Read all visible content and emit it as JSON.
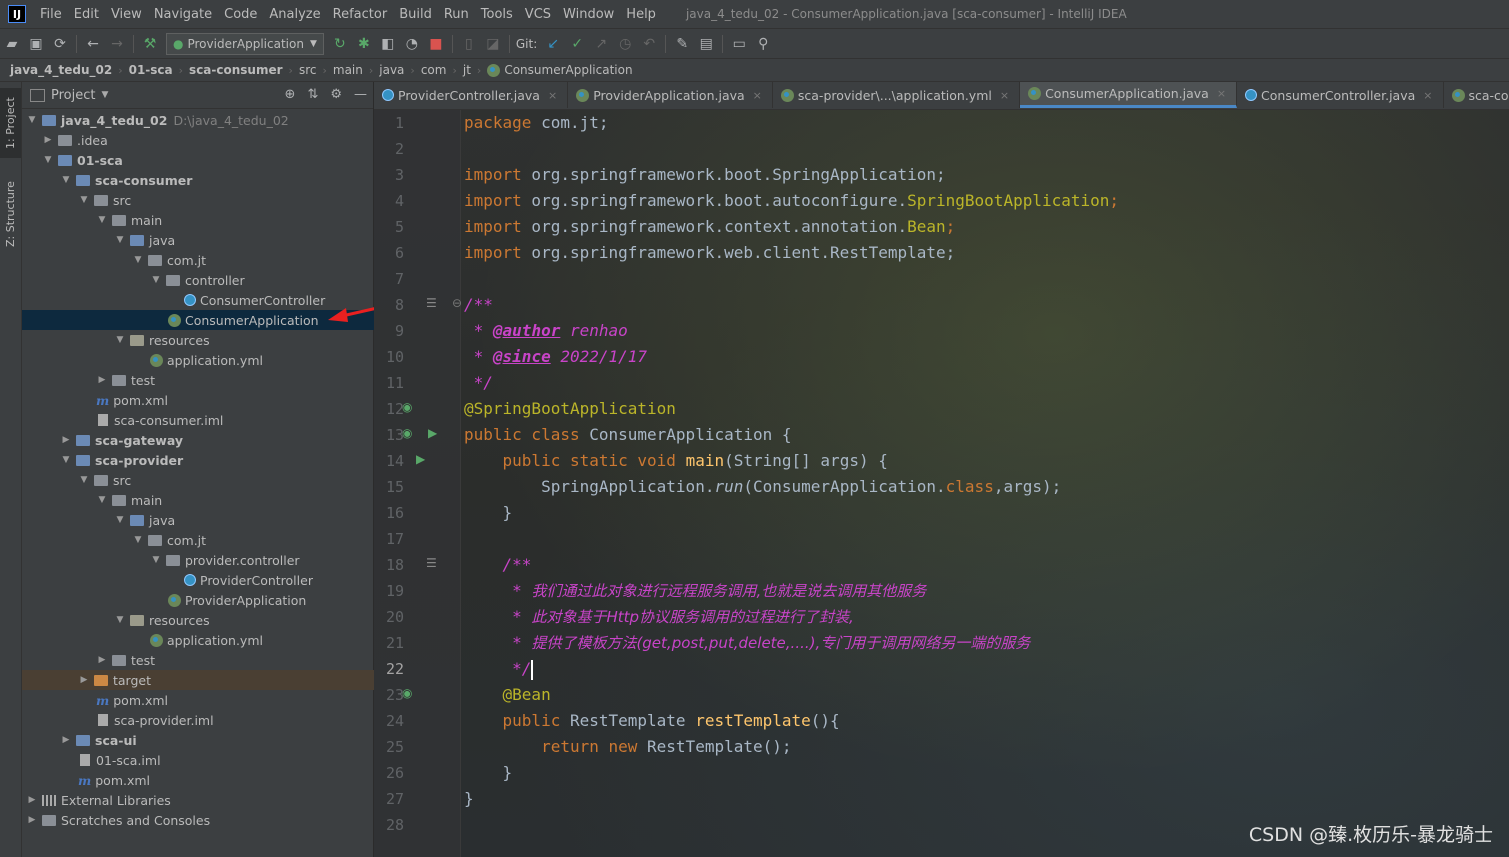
{
  "window": {
    "title": "java_4_tedu_02 - ConsumerApplication.java [sca-consumer] - IntelliJ IDEA"
  },
  "menu": [
    "File",
    "Edit",
    "View",
    "Navigate",
    "Code",
    "Analyze",
    "Refactor",
    "Build",
    "Run",
    "Tools",
    "VCS",
    "Window",
    "Help"
  ],
  "toolbar": {
    "run_config": "ProviderApplication",
    "git_label": "Git:"
  },
  "breadcrumb": [
    "java_4_tedu_02",
    "01-sca",
    "sca-consumer",
    "src",
    "main",
    "java",
    "com",
    "jt",
    "ConsumerApplication"
  ],
  "left_strip": {
    "project_tab": "1: Project",
    "structure_tab": "Z: Structure"
  },
  "project_panel": {
    "title": "Project",
    "tree": [
      {
        "label": "java_4_tedu_02",
        "path": "D:\\java_4_tedu_02"
      },
      {
        "label": ".idea"
      },
      {
        "label": "01-sca"
      },
      {
        "label": "sca-consumer"
      },
      {
        "label": "src"
      },
      {
        "label": "main"
      },
      {
        "label": "java"
      },
      {
        "label": "com.jt"
      },
      {
        "label": "controller"
      },
      {
        "label": "ConsumerController"
      },
      {
        "label": "ConsumerApplication"
      },
      {
        "label": "resources"
      },
      {
        "label": "application.yml"
      },
      {
        "label": "test"
      },
      {
        "label": "pom.xml"
      },
      {
        "label": "sca-consumer.iml"
      },
      {
        "label": "sca-gateway"
      },
      {
        "label": "sca-provider"
      },
      {
        "label": "src"
      },
      {
        "label": "main"
      },
      {
        "label": "java"
      },
      {
        "label": "com.jt"
      },
      {
        "label": "provider.controller"
      },
      {
        "label": "ProviderController"
      },
      {
        "label": "ProviderApplication"
      },
      {
        "label": "resources"
      },
      {
        "label": "application.yml"
      },
      {
        "label": "test"
      },
      {
        "label": "target"
      },
      {
        "label": "pom.xml"
      },
      {
        "label": "sca-provider.iml"
      },
      {
        "label": "sca-ui"
      },
      {
        "label": "01-sca.iml"
      },
      {
        "label": "pom.xml"
      },
      {
        "label": "External Libraries"
      },
      {
        "label": "Scratches and Consoles"
      }
    ]
  },
  "editor_tabs": [
    "ProviderController.java",
    "ProviderApplication.java",
    "sca-provider\\...\\application.yml",
    "ConsumerApplication.java",
    "ConsumerController.java",
    "sca-consumer\\...\\ap"
  ],
  "editor": {
    "line_numbers": [
      "1",
      "2",
      "3",
      "4",
      "5",
      "6",
      "7",
      "8",
      "9",
      "10",
      "11",
      "12",
      "13",
      "14",
      "15",
      "16",
      "17",
      "18",
      "19",
      "20",
      "21",
      "22",
      "23",
      "24",
      "25",
      "26",
      "27",
      "28"
    ],
    "code": {
      "l1_kw": "package",
      "l1_rest": " com.jt;",
      "l3_kw": "import",
      "l3_rest": " org.springframework.boot.SpringApplication;",
      "l4_kw": "import",
      "l4_a": " org.springframework.boot.autoconfigure.",
      "l4_b": "SpringBootApplication",
      "l4_c": ";",
      "l5_kw": "import",
      "l5_a": " org.springframework.context.annotation.",
      "l5_b": "Bean",
      "l5_c": ";",
      "l6_kw": "import",
      "l6_rest": " org.springframework.web.client.RestTemplate;",
      "l8": "/**",
      "l9_star": " * ",
      "l9_tag": "@author",
      "l9_val": " renhao",
      "l10_star": " * ",
      "l10_tag": "@since",
      "l10_val": " 2022/1/17",
      "l11": " */",
      "l12": "@SpringBootApplication",
      "l13_kw": "public class",
      "l13_rest": " ConsumerApplication {",
      "l14_kw": "    public static void ",
      "l14_fn": "main",
      "l14_rest": "(String[] args) {",
      "l15_a": "        SpringApplication.",
      "l15_fn": "run",
      "l15_b": "(ConsumerApplication.",
      "l15_kw": "class",
      "l15_c": ",args);",
      "l16": "    }",
      "l18": "    /**",
      "l19_star": "     * ",
      "l19_text": "我们通过此对象进行远程服务调用,也就是说去调用其他服务",
      "l20_star": "     * ",
      "l20_text": "此对象基于Http协议服务调用的过程进行了封装,",
      "l21_star": "     * ",
      "l21_text": "提供了模板方法(get,post,put,delete,....),专门用于调用网络另一端的服务",
      "l22": "     */",
      "l23": "    @Bean",
      "l24_kw": "    public",
      "l24_a": " RestTemplate ",
      "l24_fn": "restTemplate",
      "l24_b": "(){",
      "l25_kw": "        return new",
      "l25_rest": " RestTemplate();",
      "l26": "    }",
      "l27": "}"
    }
  },
  "watermark": "CSDN @臻.枚历乐-暴龙骑士",
  "colors": {
    "keyword": "#cc7832",
    "annotation": "#bbb529",
    "method": "#ffc66d",
    "javadoc": "#c844c8",
    "selection": "#0d293e",
    "arrow": "#e82020"
  }
}
